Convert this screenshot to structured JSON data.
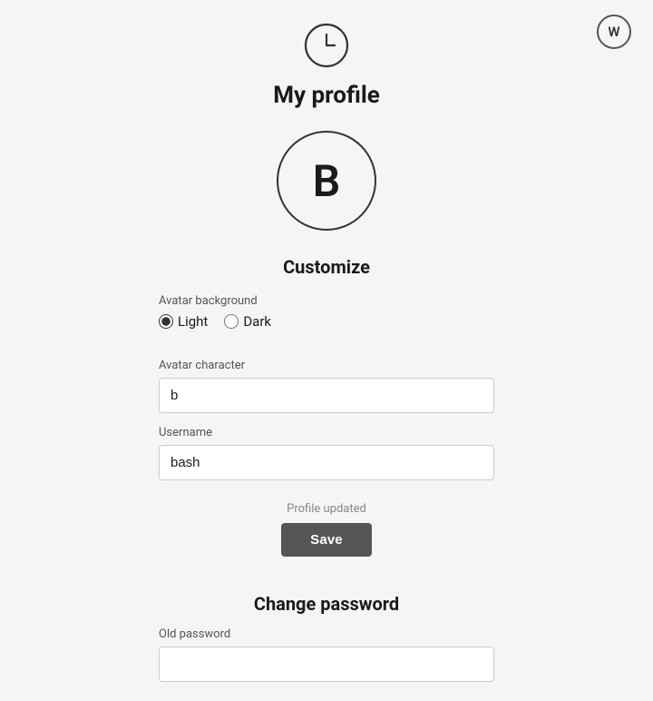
{
  "topAvatar": {
    "label": "W"
  },
  "pageTitle": "My profile",
  "profileAvatar": {
    "character": "B"
  },
  "customizeSection": {
    "title": "Customize",
    "avatarBackground": {
      "label": "Avatar background",
      "options": [
        {
          "value": "light",
          "label": "Light",
          "checked": true
        },
        {
          "value": "dark",
          "label": "Dark",
          "checked": false
        }
      ]
    },
    "avatarCharacter": {
      "label": "Avatar character",
      "value": "b"
    },
    "username": {
      "label": "Username",
      "value": "bash"
    },
    "profileUpdatedText": "Profile updated",
    "saveButtonLabel": "Save"
  },
  "changePasswordSection": {
    "title": "Change password",
    "oldPasswordLabel": "Old password",
    "oldPasswordValue": ""
  }
}
